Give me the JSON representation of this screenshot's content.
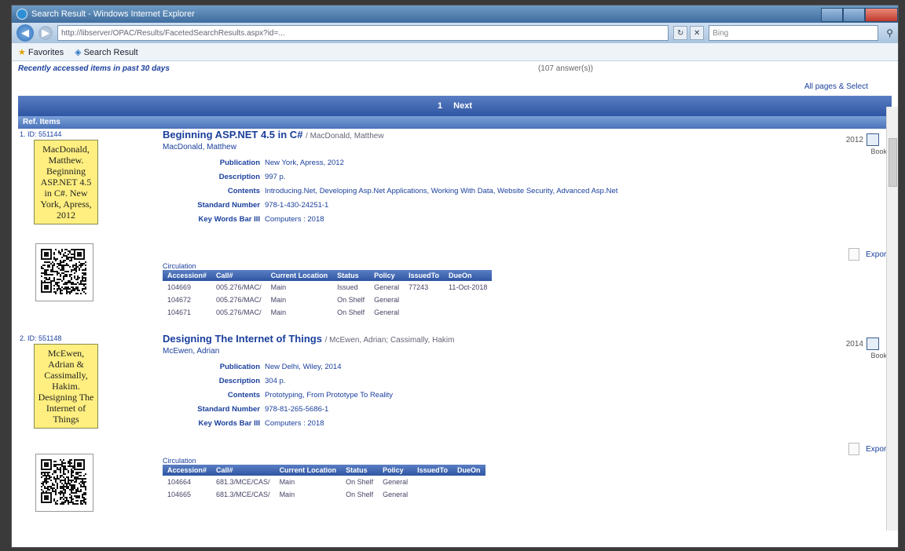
{
  "window": {
    "title": "Search Result - Windows Internet Explorer"
  },
  "browser": {
    "address": "http://libserver/OPAC/Results/FacetedSearchResults.aspx?id=...",
    "search_placeholder": "Bing",
    "favorites_label": "Favorites",
    "tab_label": "Search Result"
  },
  "page": {
    "recent_label": "Recently accessed items in past 30 days",
    "count_label": "(107 answer(s))",
    "all_pages_label": "All pages & Select",
    "pager": {
      "current": "1",
      "next_label": "Next"
    },
    "list_header": "Ref. Items"
  },
  "records": [
    {
      "number": "1. ID: 551144",
      "card_text": "MacDonald, Matthew. Beginning ASP.NET 4.5 in C#. New York, Apress, 2012",
      "title": "Beginning ASP.NET 4.5 in C#",
      "responsibility": "/ MacDonald, Matthew",
      "author": "MacDonald, Matthew",
      "year": "2012",
      "type": "Book",
      "fields": [
        {
          "label": "Publication",
          "value": "New York, Apress, 2012"
        },
        {
          "label": "Description",
          "value": "997 p."
        },
        {
          "label": "Contents",
          "value": "Introducing.Net, Developing Asp.Net Applications, Working With Data, Website Security, Advanced Asp.Net"
        },
        {
          "label": "Standard Number",
          "value": "978-1-430-24251-1"
        },
        {
          "label": "Key Words Bar III",
          "value": "Computers : 2018"
        }
      ],
      "export_label": "Export",
      "circulation_label": "Circulation",
      "copies_header": [
        "Accession#",
        "Call#",
        "Current Location",
        "Status",
        "Policy",
        "IssuedTo",
        "DueOn"
      ],
      "copies": [
        [
          "104669",
          "005.276/MAC/",
          "Main",
          "Issued",
          "General",
          "77243",
          "11-Oct-2018"
        ],
        [
          "104672",
          "005.276/MAC/",
          "Main",
          "On Shelf",
          "General",
          "",
          ""
        ],
        [
          "104671",
          "005.276/MAC/",
          "Main",
          "On Shelf",
          "General",
          "",
          ""
        ]
      ]
    },
    {
      "number": "2. ID: 551148",
      "card_text": "McEwen, Adrian & Cassimally, Hakim. Designing The Internet of Things",
      "title": "Designing The Internet of Things",
      "responsibility": "/ McEwen, Adrian; Cassimally, Hakim",
      "author": "McEwen, Adrian",
      "year": "2014",
      "type": "Book",
      "fields": [
        {
          "label": "Publication",
          "value": "New Delhi, Wiley, 2014"
        },
        {
          "label": "Description",
          "value": "304 p."
        },
        {
          "label": "Contents",
          "value": "Prototyping, From Prototype To Reality"
        },
        {
          "label": "Standard Number",
          "value": "978-81-265-5686-1"
        },
        {
          "label": "Key Words Bar III",
          "value": "Computers : 2018"
        }
      ],
      "export_label": "Export",
      "circulation_label": "Circulation",
      "copies_header": [
        "Accession#",
        "Call#",
        "Current Location",
        "Status",
        "Policy",
        "IssuedTo",
        "DueOn"
      ],
      "copies": [
        [
          "104664",
          "681.3/MCE/CAS/",
          "Main",
          "On Shelf",
          "General",
          "",
          ""
        ],
        [
          "104665",
          "681.3/MCE/CAS/",
          "Main",
          "On Shelf",
          "General",
          "",
          ""
        ]
      ]
    }
  ]
}
